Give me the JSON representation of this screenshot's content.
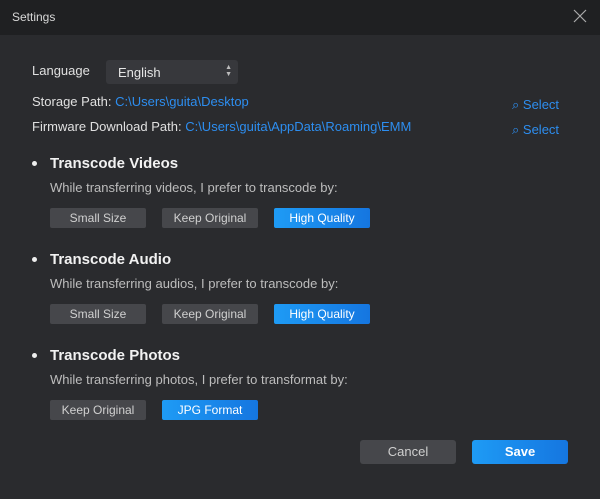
{
  "window": {
    "title": "Settings"
  },
  "language": {
    "label": "Language",
    "value": "English"
  },
  "storage": {
    "label": "Storage Path:",
    "path": "C:\\Users\\guita\\Desktop",
    "select": "Select"
  },
  "firmware": {
    "label": "Firmware Download Path:",
    "path": "C:\\Users\\guita\\AppData\\Roaming\\EMM",
    "select": "Select"
  },
  "sections": [
    {
      "title": "Transcode Videos",
      "desc": "While transferring videos, I prefer to transcode by:",
      "options": [
        "Small Size",
        "Keep Original",
        "High Quality"
      ],
      "selected": "High Quality"
    },
    {
      "title": "Transcode Audio",
      "desc": "While transferring audios, I prefer to transcode by:",
      "options": [
        "Small Size",
        "Keep Original",
        "High Quality"
      ],
      "selected": "High Quality"
    },
    {
      "title": "Transcode Photos",
      "desc": "While transferring photos, I prefer to transformat by:",
      "options": [
        "Keep Original",
        "JPG Format"
      ],
      "selected": "JPG Format"
    }
  ],
  "buttons": {
    "cancel": "Cancel",
    "save": "Save"
  },
  "colors": {
    "accent": "#1e8cf0",
    "background": "#2a2b2e"
  }
}
